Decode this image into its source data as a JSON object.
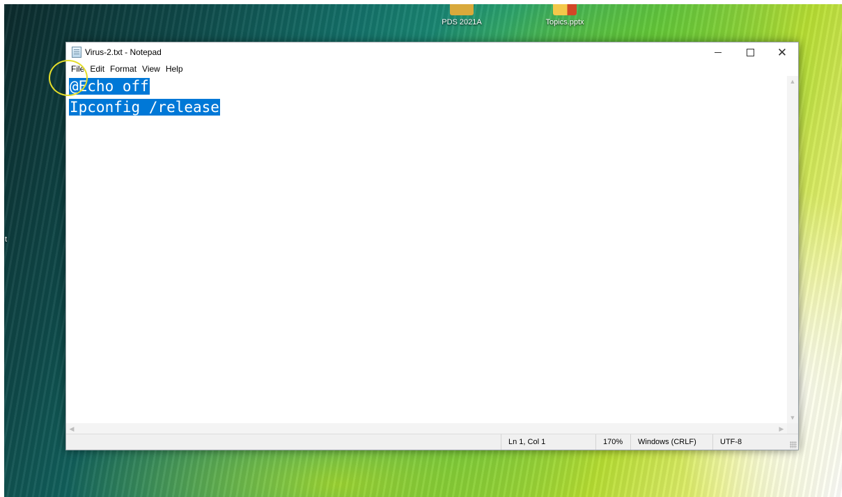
{
  "desktop": {
    "icons": [
      {
        "label": "PDS 2021A",
        "icon": "folder-app-icon",
        "color": "#d9a93b"
      },
      {
        "label": "Topics.pptx",
        "icon": "powerpoint-file-icon",
        "color": "#d24726"
      }
    ],
    "edge_mark": "t"
  },
  "window": {
    "title": "Virus-2.txt - Notepad",
    "app_icon": "notepad-icon",
    "controls": {
      "minimize": "minimize-icon",
      "maximize": "maximize-icon",
      "close": "close-icon"
    }
  },
  "menu": {
    "items": [
      {
        "label": "File"
      },
      {
        "label": "Edit"
      },
      {
        "label": "Format"
      },
      {
        "label": "View"
      },
      {
        "label": "Help"
      }
    ]
  },
  "editor": {
    "lines": [
      "@Echo off",
      "Ipconfig /release"
    ],
    "selection_color": "#0078d7"
  },
  "status": {
    "position": "Ln 1, Col 1",
    "zoom": "170%",
    "line_ending": "Windows (CRLF)",
    "encoding": "UTF-8"
  },
  "annotation": {
    "highlight_color": "#e4dd2a"
  }
}
